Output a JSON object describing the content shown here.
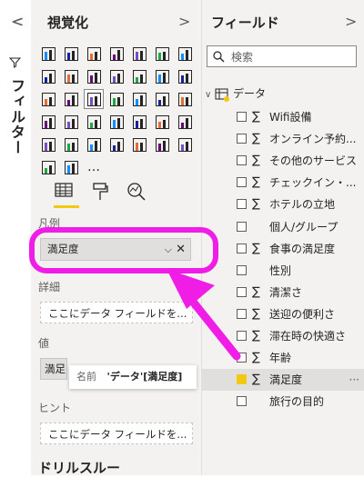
{
  "filter_pane": {
    "collapse_chevron": "<",
    "title": "フィルター"
  },
  "viz_pane": {
    "collapse_chevron": "<",
    "title": "視覚化",
    "expand_chevron": ">",
    "icons": [
      "stacked-bar",
      "stacked-column",
      "clustered-bar",
      "clustered-column",
      "100-bar",
      "100-column",
      "line-chart",
      "area-chart",
      "stacked-area",
      "line-column",
      "line-clustered",
      "ribbon",
      "waterfall",
      "funnel",
      "scatter",
      "pie",
      "donut",
      "treemap",
      "map",
      "filled-map",
      "shape-map",
      "gauge",
      "card",
      "multi-row-card",
      "kpi",
      "slicer",
      "table",
      "matrix",
      "r-visual",
      "python-visual",
      "key-influencers",
      "decomposition-tree",
      "qa",
      "smart-narrative",
      "paginated",
      "power-apps",
      "power-automate",
      "more"
    ],
    "more_glyph": "…",
    "tabs": [
      "fields-tab",
      "format-tab",
      "analytics-tab"
    ],
    "wells": [
      {
        "label": "凡例",
        "value": "満足度"
      },
      {
        "label": "詳細",
        "placeholder": "ここにデータ フィールドを..."
      },
      {
        "label": "値",
        "value": "満足"
      },
      {
        "label": "ヒント",
        "placeholder": "ここにデータ フィールドを..."
      }
    ],
    "drillthrough": "ドリルスルー",
    "tooltip": {
      "name_label": "名前",
      "name_value": "'データ'[満足度]"
    }
  },
  "fields_pane": {
    "title": "フィールド",
    "expand_chevron": ">",
    "search_placeholder": "検索",
    "table_name": "データ",
    "fields": [
      {
        "name": "Wifi設備",
        "sigma": true,
        "checked": false
      },
      {
        "name": "オンライン予約...",
        "sigma": true,
        "checked": false
      },
      {
        "name": "その他のサービス",
        "sigma": true,
        "checked": false
      },
      {
        "name": "チェックイン・...",
        "sigma": true,
        "checked": false
      },
      {
        "name": "ホテルの立地",
        "sigma": true,
        "checked": false
      },
      {
        "name": "個人/グループ",
        "sigma": false,
        "checked": false
      },
      {
        "name": "食事の満足度",
        "sigma": true,
        "checked": false
      },
      {
        "name": "性別",
        "sigma": false,
        "checked": false
      },
      {
        "name": "清潔さ",
        "sigma": true,
        "checked": false
      },
      {
        "name": "送迎の便利さ",
        "sigma": true,
        "checked": false
      },
      {
        "name": "滞在時の快適さ",
        "sigma": true,
        "checked": false
      },
      {
        "name": "年齢",
        "sigma": true,
        "checked": false
      },
      {
        "name": "満足度",
        "sigma": true,
        "checked": true
      },
      {
        "name": "旅行の目的",
        "sigma": false,
        "checked": false
      }
    ],
    "sigma_glyph": "∑",
    "more_glyph": "···"
  },
  "colors": {
    "highlight": "#f01de6",
    "accent_yellow": "#f2c811"
  }
}
